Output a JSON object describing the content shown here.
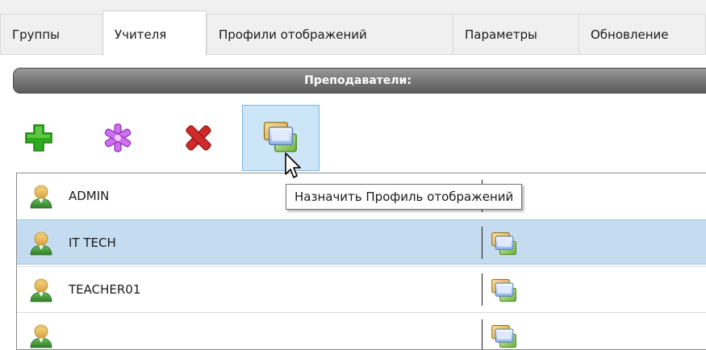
{
  "tabs": [
    {
      "label": "Группы",
      "active": false
    },
    {
      "label": "Учителя",
      "active": true
    },
    {
      "label": "Профили отображений",
      "active": false
    },
    {
      "label": "Параметры",
      "active": false
    },
    {
      "label": "Обновление",
      "active": false
    }
  ],
  "header": {
    "title": "Преподаватели:"
  },
  "toolbar": {
    "buttons": [
      {
        "icon": "plus-icon",
        "color": "#2eaa1e"
      },
      {
        "icon": "asterisk-icon",
        "color": "#c14ee0"
      },
      {
        "icon": "x-icon",
        "color": "#d02a2a"
      },
      {
        "icon": "assign-profile-icon",
        "hovered": true
      }
    ]
  },
  "tooltip": {
    "text": "Назначить Профиль отображений"
  },
  "teachers": [
    {
      "name": "ADMIN",
      "selected": false
    },
    {
      "name": "IT TECH",
      "selected": true
    },
    {
      "name": "TEACHER01",
      "selected": false
    },
    {
      "name": "",
      "selected": false
    }
  ],
  "colors": {
    "selection": "#c5dcf0",
    "hover": "#cde6f7",
    "header": "#6e6e6e"
  }
}
